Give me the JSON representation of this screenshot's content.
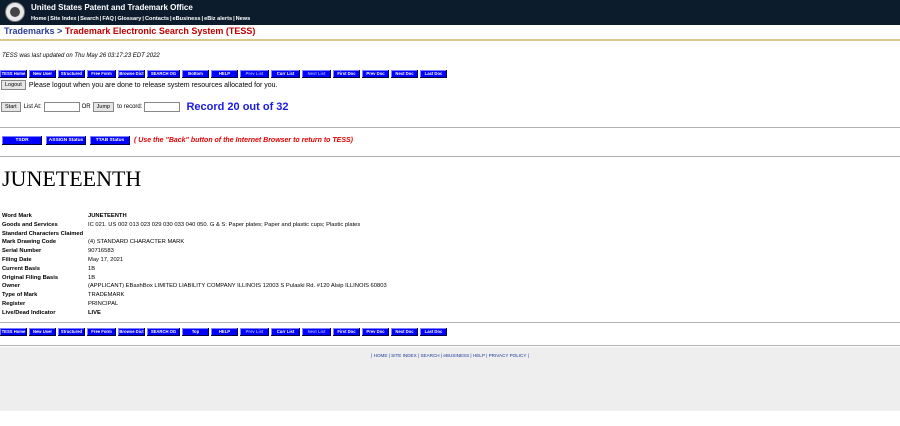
{
  "header": {
    "org": "United States Patent and Trademark Office",
    "nav": [
      "Home",
      "Site Index",
      "Search",
      "FAQ",
      "Glossary",
      "Contacts",
      "eBusiness",
      "eBiz alerts",
      "News"
    ]
  },
  "breadcrumb": {
    "root": "Trademarks",
    "sep": ">",
    "current": "Trademark Electronic Search System (TESS)"
  },
  "updated": "TESS was last updated on Thu May 26 03:17:23 EDT 2022",
  "toolbar_top": [
    "TESS Home",
    "New User",
    "Structured",
    "Free Form",
    "Browse Dict",
    "SEARCH OG",
    "Bottom",
    "HELP",
    "Prev List",
    "Curr List",
    "Next List",
    "First Doc",
    "Prev Doc",
    "Next Doc",
    "Last Doc"
  ],
  "toolbar_bottom": [
    "TESS Home",
    "New User",
    "Structured",
    "Free Form",
    "Browse Dict",
    "SEARCH OG",
    "Top",
    "HELP",
    "Prev List",
    "Curr List",
    "Next List",
    "First Doc",
    "Prev Doc",
    "Next Doc",
    "Last Doc"
  ],
  "logout": {
    "button": "Logout",
    "message": "Please logout when you are done to release system resources allocated for you."
  },
  "nav_record": {
    "start": "Start",
    "list_at": "List At:",
    "or": "OR",
    "jump": "Jump",
    "to_record": "to record:",
    "record": "Record 20 out of 32"
  },
  "status_buttons": {
    "tsdr": "TSDR",
    "assign": "ASSIGN Status",
    "ttab": "TTAB Status"
  },
  "back_note": "( Use the \"Back\" button of the Internet Browser to return to TESS)",
  "mark_image_text": "JUNETEENTH",
  "details": [
    {
      "k": "Word Mark",
      "v": "JUNETEENTH"
    },
    {
      "k": "Goods and Services",
      "v": "IC 021. US 002 013 023 029 030 033 040 050. G & S: Paper plates; Paper and plastic cups; Plastic plates"
    },
    {
      "k": "Standard Characters Claimed",
      "v": ""
    },
    {
      "k": "Mark Drawing Code",
      "v": "(4) STANDARD CHARACTER MARK"
    },
    {
      "k": "Serial Number",
      "v": "90716583"
    },
    {
      "k": "Filing Date",
      "v": "May 17, 2021"
    },
    {
      "k": "Current Basis",
      "v": "1B"
    },
    {
      "k": "Original Filing Basis",
      "v": "1B"
    },
    {
      "k": "Owner",
      "v": "(APPLICANT) EBashBox LIMITED LIABILITY COMPANY ILLINOIS 12003 S Pulaski Rd. #120 Alsip ILLINOIS 60803"
    },
    {
      "k": "Type of Mark",
      "v": "TRADEMARK"
    },
    {
      "k": "Register",
      "v": "PRINCIPAL"
    },
    {
      "k": "Live/Dead Indicator",
      "v": "LIVE"
    }
  ],
  "footer_links": [
    "HOME",
    "SITE INDEX",
    "SEARCH",
    "eBUSINESS",
    "HELP",
    "PRIVACY POLICY"
  ],
  "colors": {
    "header_bg": "#0c1c2c",
    "button_blue": "#0000ff",
    "record_blue": "#1a1ae6",
    "warning_red": "#e00000",
    "tess_red": "#c00000"
  }
}
